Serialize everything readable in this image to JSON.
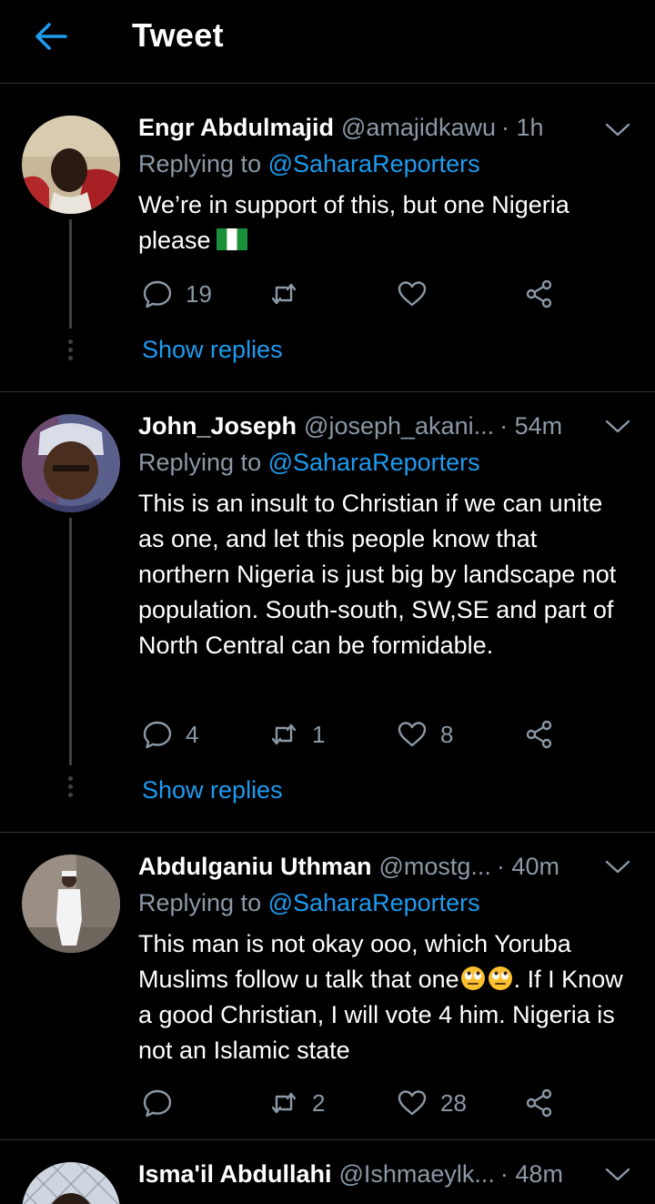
{
  "header": {
    "title": "Tweet"
  },
  "tweets": [
    {
      "name": "Engr Abdulmajid",
      "handle": "@amajidkawu",
      "time": "· 1h",
      "replying_prefix": "Replying to ",
      "replying_to": "@SaharaReporters",
      "text": "We’re in support of this, but one Nigeria please",
      "trailing_icon": "nigeria-flag",
      "reply_count": "19",
      "retweet_count": "",
      "like_count": "",
      "show_replies": "Show replies"
    },
    {
      "name": "John_Joseph",
      "handle": "@joseph_akani...",
      "time": "· 54m",
      "replying_prefix": "Replying to ",
      "replying_to": "@SaharaReporters",
      "text": "This is an insult to Christian if we can unite as one, and let this people know that northern Nigeria is just big by landscape not population. South-south, SW,SE and part of North Central can be formidable.",
      "reply_count": "4",
      "retweet_count": "1",
      "like_count": "8",
      "show_replies": "Show replies"
    },
    {
      "name": "Abdulganiu Uthman",
      "handle": "@mostg...",
      "time": "· 40m",
      "replying_prefix": "Replying to ",
      "replying_to": "@SaharaReporters",
      "text_before_emoji": "This man is not okay ooo, which Yoruba Muslims follow u talk that one",
      "inline_icons": [
        "face-with-rolling-eyes",
        "face-with-rolling-eyes"
      ],
      "text_after_emoji": ". If I Know a good Christian, I will vote 4 him. Nigeria is not an Islamic state",
      "reply_count": "",
      "retweet_count": "2",
      "like_count": "28"
    },
    {
      "name": "Isma'il Abdullahi",
      "handle": "@Ishmaeylk...",
      "time": "· 48m"
    }
  ]
}
